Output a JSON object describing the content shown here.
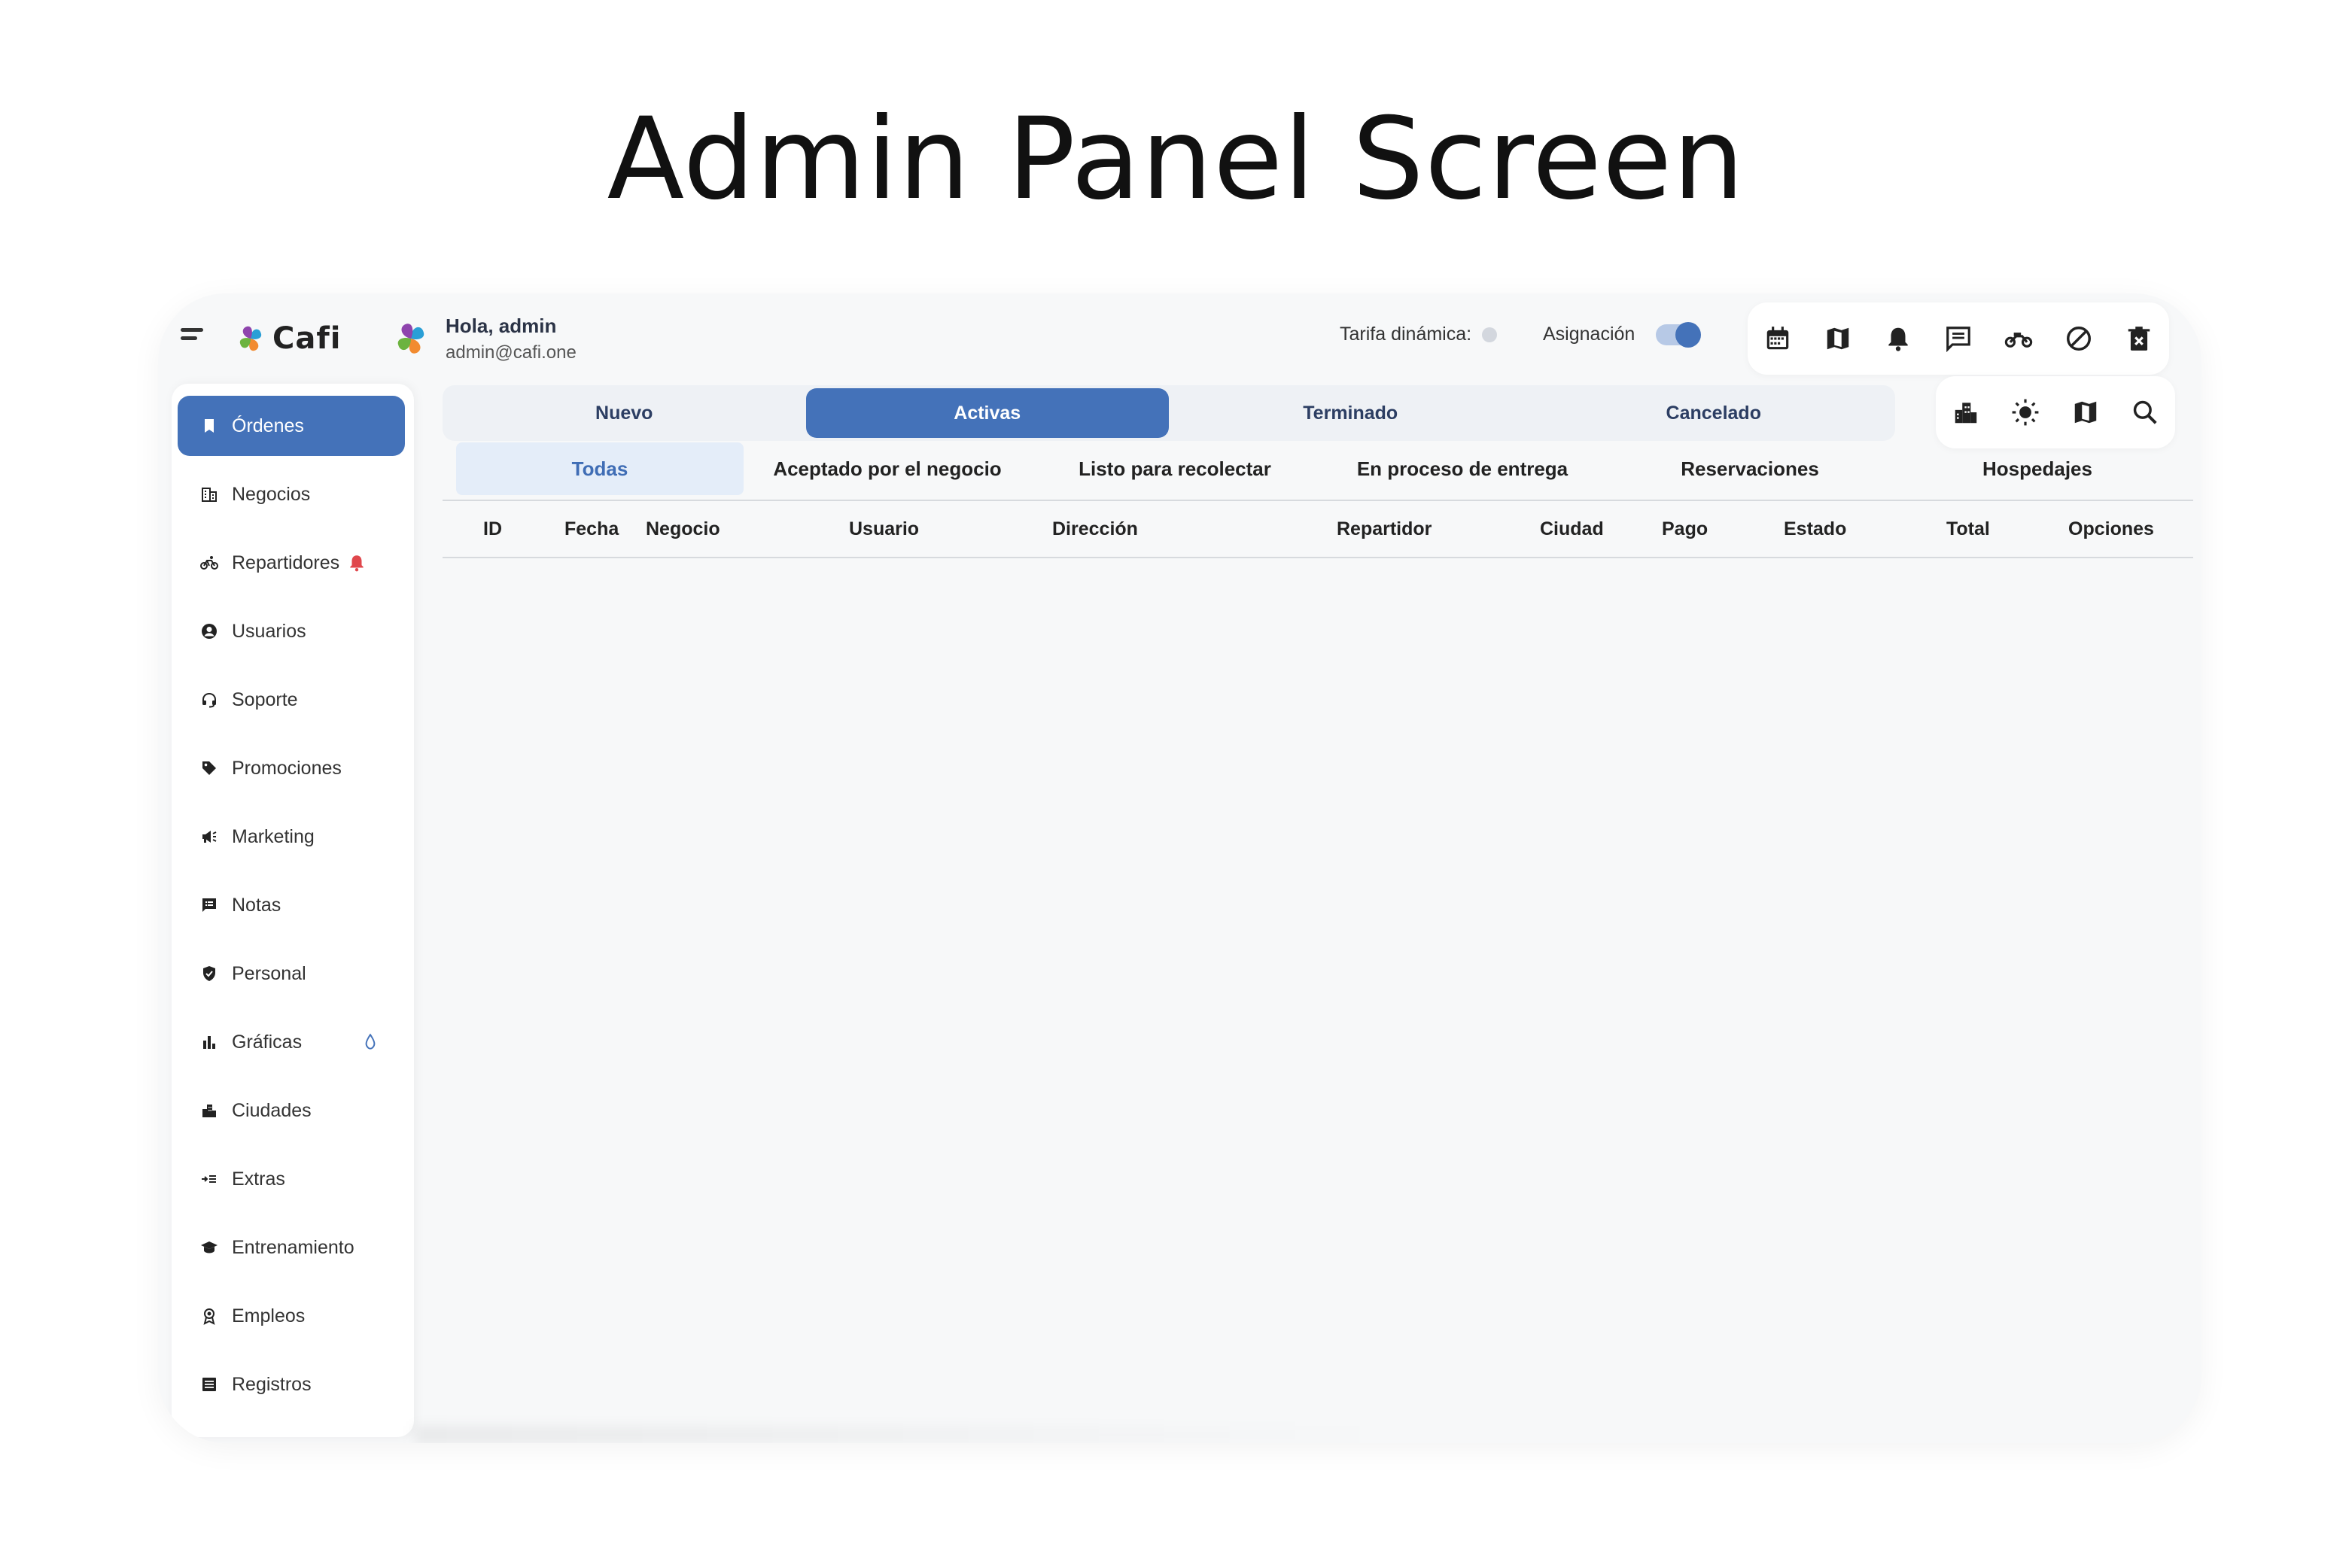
{
  "slide_title": "Admin Panel Screen",
  "brand": {
    "name": "Cafi"
  },
  "user": {
    "greeting": "Hola, admin",
    "email": "admin@cafi.one"
  },
  "header": {
    "tarifa_label": "Tarifa dinámica:",
    "asignacion_label": "Asignación",
    "asignacion_on": true,
    "icons": [
      "calendar-icon",
      "map-icon",
      "bell-icon",
      "chat-icon",
      "motorcycle-icon",
      "block-icon",
      "delete-icon"
    ]
  },
  "sidebar": {
    "items": [
      {
        "label": "Órdenes",
        "icon": "bookmark-icon",
        "active": true
      },
      {
        "label": "Negocios",
        "icon": "business-icon"
      },
      {
        "label": "Repartidores",
        "icon": "bike-icon",
        "alert": "bell-alert-icon"
      },
      {
        "label": "Usuarios",
        "icon": "account-icon"
      },
      {
        "label": "Soporte",
        "icon": "headset-icon"
      },
      {
        "label": "Promociones",
        "icon": "tag-icon"
      },
      {
        "label": "Marketing",
        "icon": "megaphone-icon"
      },
      {
        "label": "Notas",
        "icon": "note-icon"
      },
      {
        "label": "Personal",
        "icon": "shield-icon"
      },
      {
        "label": "Gráficas",
        "icon": "bar-chart-icon",
        "extra": "water-drop-icon"
      },
      {
        "label": "Ciudades",
        "icon": "city-icon"
      },
      {
        "label": "Extras",
        "icon": "extras-icon"
      },
      {
        "label": "Entrenamiento",
        "icon": "school-icon"
      },
      {
        "label": "Empleos",
        "icon": "award-icon"
      },
      {
        "label": "Registros",
        "icon": "list-icon"
      }
    ]
  },
  "tabs": [
    {
      "label": "Nuevo"
    },
    {
      "label": "Activas",
      "active": true
    },
    {
      "label": "Terminado"
    },
    {
      "label": "Cancelado"
    }
  ],
  "tools": [
    "city-icon",
    "sun-icon",
    "map-icon",
    "search-icon"
  ],
  "subtabs": [
    {
      "label": "Todas",
      "active": true
    },
    {
      "label": "Aceptado por el negocio"
    },
    {
      "label": "Listo para recolectar"
    },
    {
      "label": "En proceso de entrega"
    },
    {
      "label": "Reservaciones"
    },
    {
      "label": "Hospedajes"
    }
  ],
  "table": {
    "columns": [
      "ID",
      "Fecha",
      "Negocio",
      "Usuario",
      "Dirección",
      "Repartidor",
      "Ciudad",
      "Pago",
      "Estado",
      "Total",
      "Opciones"
    ]
  },
  "colors": {
    "accent": "#4472b9",
    "alert": "#e0474c",
    "background": "#f7f8f9"
  }
}
